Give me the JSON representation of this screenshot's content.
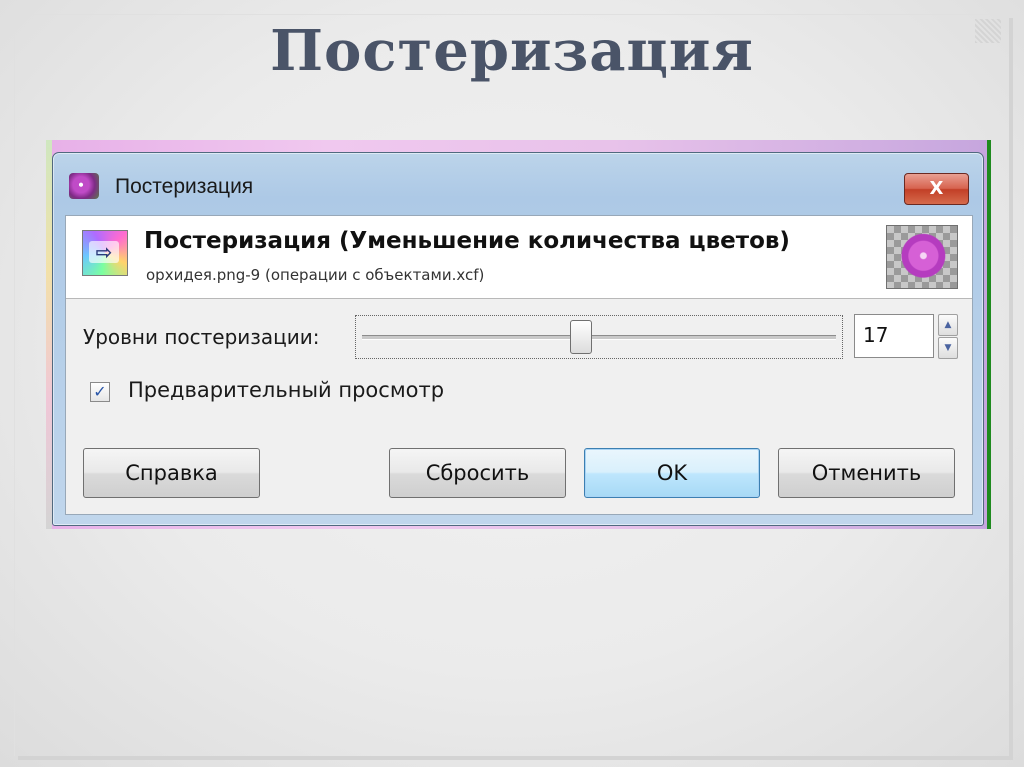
{
  "slide": {
    "title": "Постеризация"
  },
  "window": {
    "title": "Постеризация",
    "close_label": "X",
    "icon": "orchid-app-icon"
  },
  "header": {
    "title": "Постеризация (Уменьшение количества цветов)",
    "subtitle": "орхидея.png-9 (операции с объектами.xcf)",
    "icon": "posterize-filter-icon",
    "thumbnail": "orchid-thumbnail"
  },
  "levels": {
    "label": "Уровни постеризации:",
    "value": "17",
    "slider_fraction": 0.46
  },
  "preview": {
    "label": "Предварительный просмотр",
    "checked": true,
    "check_mark": "✓"
  },
  "buttons": {
    "help": "Справка",
    "reset": "Сбросить",
    "ok": "OK",
    "cancel": "Отменить"
  },
  "colors": {
    "title_text": "#4a5468",
    "close_button": "#c23f27",
    "ok_border": "#3c7fb1"
  }
}
